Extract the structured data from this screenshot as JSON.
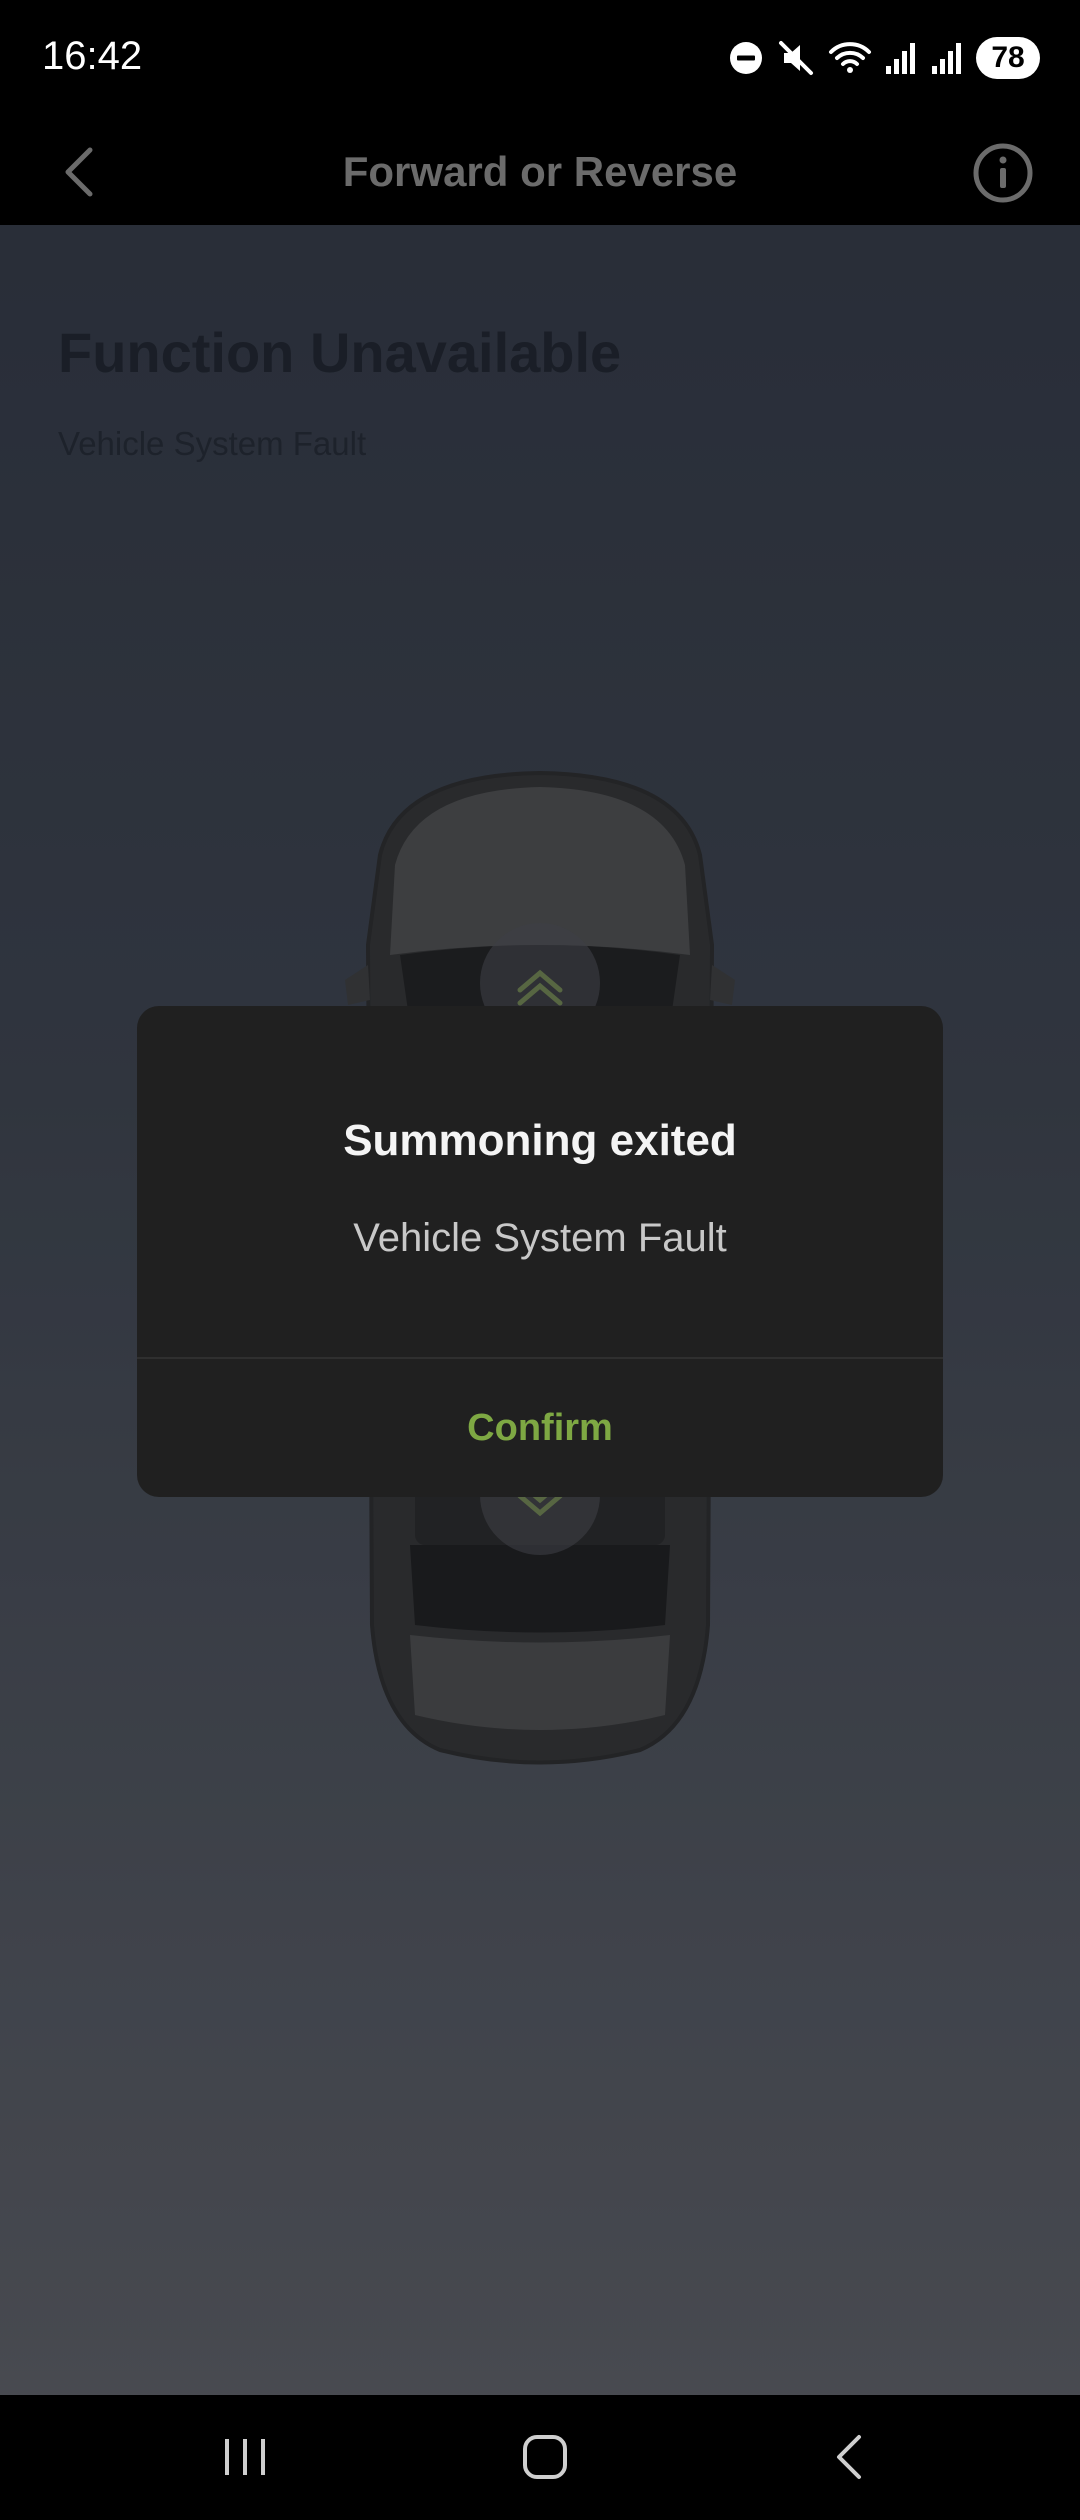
{
  "status_bar": {
    "time": "16:42",
    "battery": "78",
    "icons": [
      "do-not-disturb-icon",
      "mute-icon",
      "wifi-icon",
      "signal-icon",
      "signal-icon"
    ]
  },
  "header": {
    "title": "Forward or Reverse",
    "back_icon": "chevron-left-icon",
    "info_icon": "info-icon"
  },
  "main": {
    "status_title": "Function Unavailable",
    "status_subtitle": "Vehicle System Fault"
  },
  "dialog": {
    "title": "Summoning exited",
    "message": "Vehicle System Fault",
    "confirm_label": "Confirm",
    "confirm_color": "#7ea843"
  },
  "nav_bar": {
    "items": [
      "recents-icon",
      "home-icon",
      "back-icon"
    ]
  }
}
